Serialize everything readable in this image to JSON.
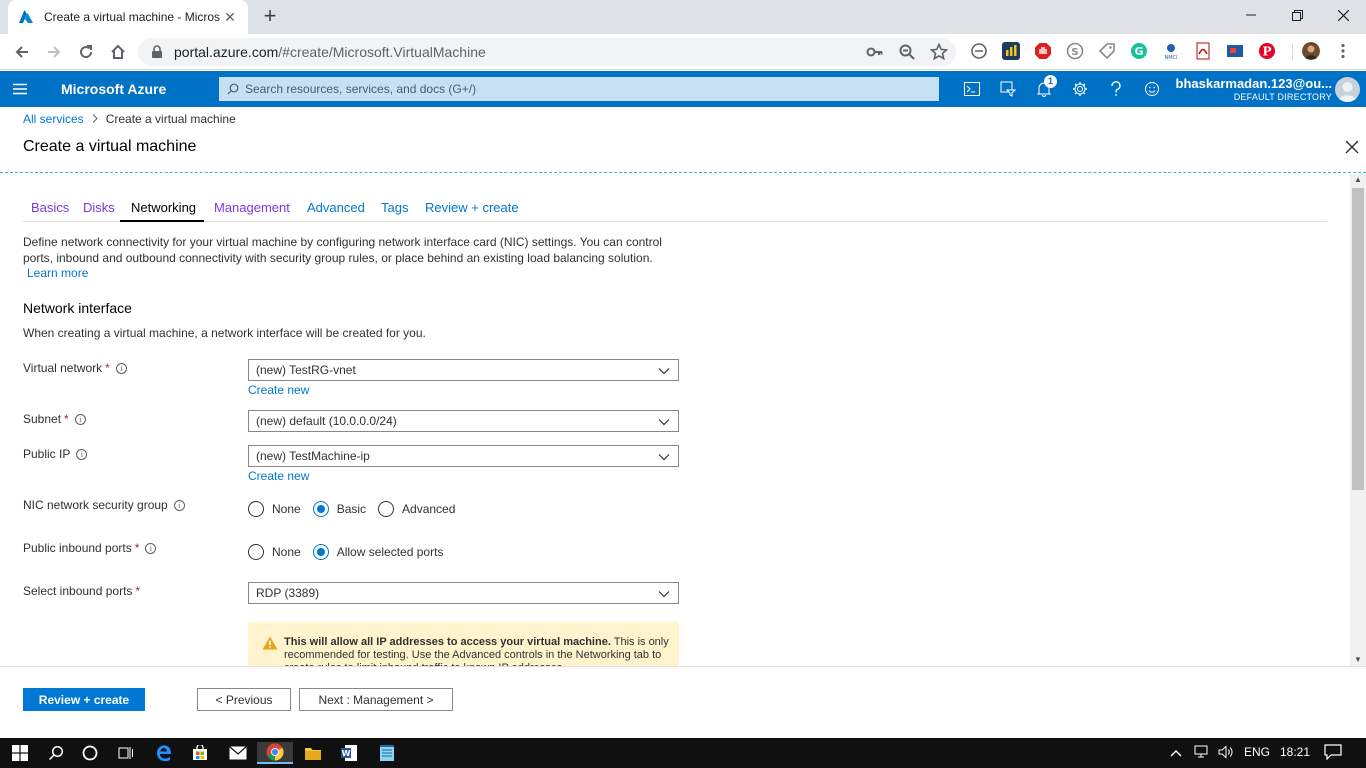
{
  "browser": {
    "tab_title": "Create a virtual machine - Micros",
    "url_host": "portal.azure.com",
    "url_path": "/#create/Microsoft.VirtualMachine"
  },
  "azure": {
    "brand": "Microsoft Azure",
    "search_placeholder": "Search resources, services, and docs (G+/)",
    "notification_count": "1",
    "user_email": "bhaskarmadan.123@ou...",
    "user_directory": "DEFAULT DIRECTORY"
  },
  "breadcrumb": {
    "root": "All services",
    "current": "Create a virtual machine"
  },
  "page_title": "Create a virtual machine",
  "tabs": [
    {
      "label": "Basics"
    },
    {
      "label": "Disks"
    },
    {
      "label": "Networking"
    },
    {
      "label": "Management"
    },
    {
      "label": "Advanced"
    },
    {
      "label": "Tags"
    },
    {
      "label": "Review + create"
    }
  ],
  "description": "Define network connectivity for your virtual machine by configuring network interface card (NIC) settings. You can control ports, inbound and outbound connectivity with security group rules, or place behind an existing load balancing solution.",
  "learn_more": "Learn more",
  "section": {
    "title": "Network interface",
    "subtitle": "When creating a virtual machine, a network interface will be created for you."
  },
  "fields": {
    "virtual_network": {
      "label": "Virtual network",
      "value": "(new) TestRG-vnet",
      "create_new": "Create new"
    },
    "subnet": {
      "label": "Subnet",
      "value": "(new) default (10.0.0.0/24)"
    },
    "public_ip": {
      "label": "Public IP",
      "value": "(new) TestMachine-ip",
      "create_new": "Create new"
    },
    "nic_nsg": {
      "label": "NIC network security group",
      "options": [
        "None",
        "Basic",
        "Advanced"
      ],
      "selected": "Basic"
    },
    "public_inbound_ports": {
      "label": "Public inbound ports",
      "options": [
        "None",
        "Allow selected ports"
      ],
      "selected": "Allow selected ports"
    },
    "select_inbound_ports": {
      "label": "Select inbound ports",
      "value": "RDP (3389)"
    }
  },
  "warning": {
    "bold": "This will allow all IP addresses to access your virtual machine.",
    "text": " This is only recommended for testing.  Use the Advanced controls in the Networking tab to create rules to limit inbound traffic to known IP addresses."
  },
  "footer": {
    "review_create": "Review + create",
    "previous": "< Previous",
    "next": "Next : Management >"
  },
  "taskbar": {
    "language": "ENG",
    "time": "18:21"
  },
  "colors": {
    "azure_blue": "#0072c6",
    "link_blue": "#0078d4",
    "visited_purple": "#773adc",
    "required_red": "#a4262c",
    "warning_bg": "#fff4ce"
  }
}
